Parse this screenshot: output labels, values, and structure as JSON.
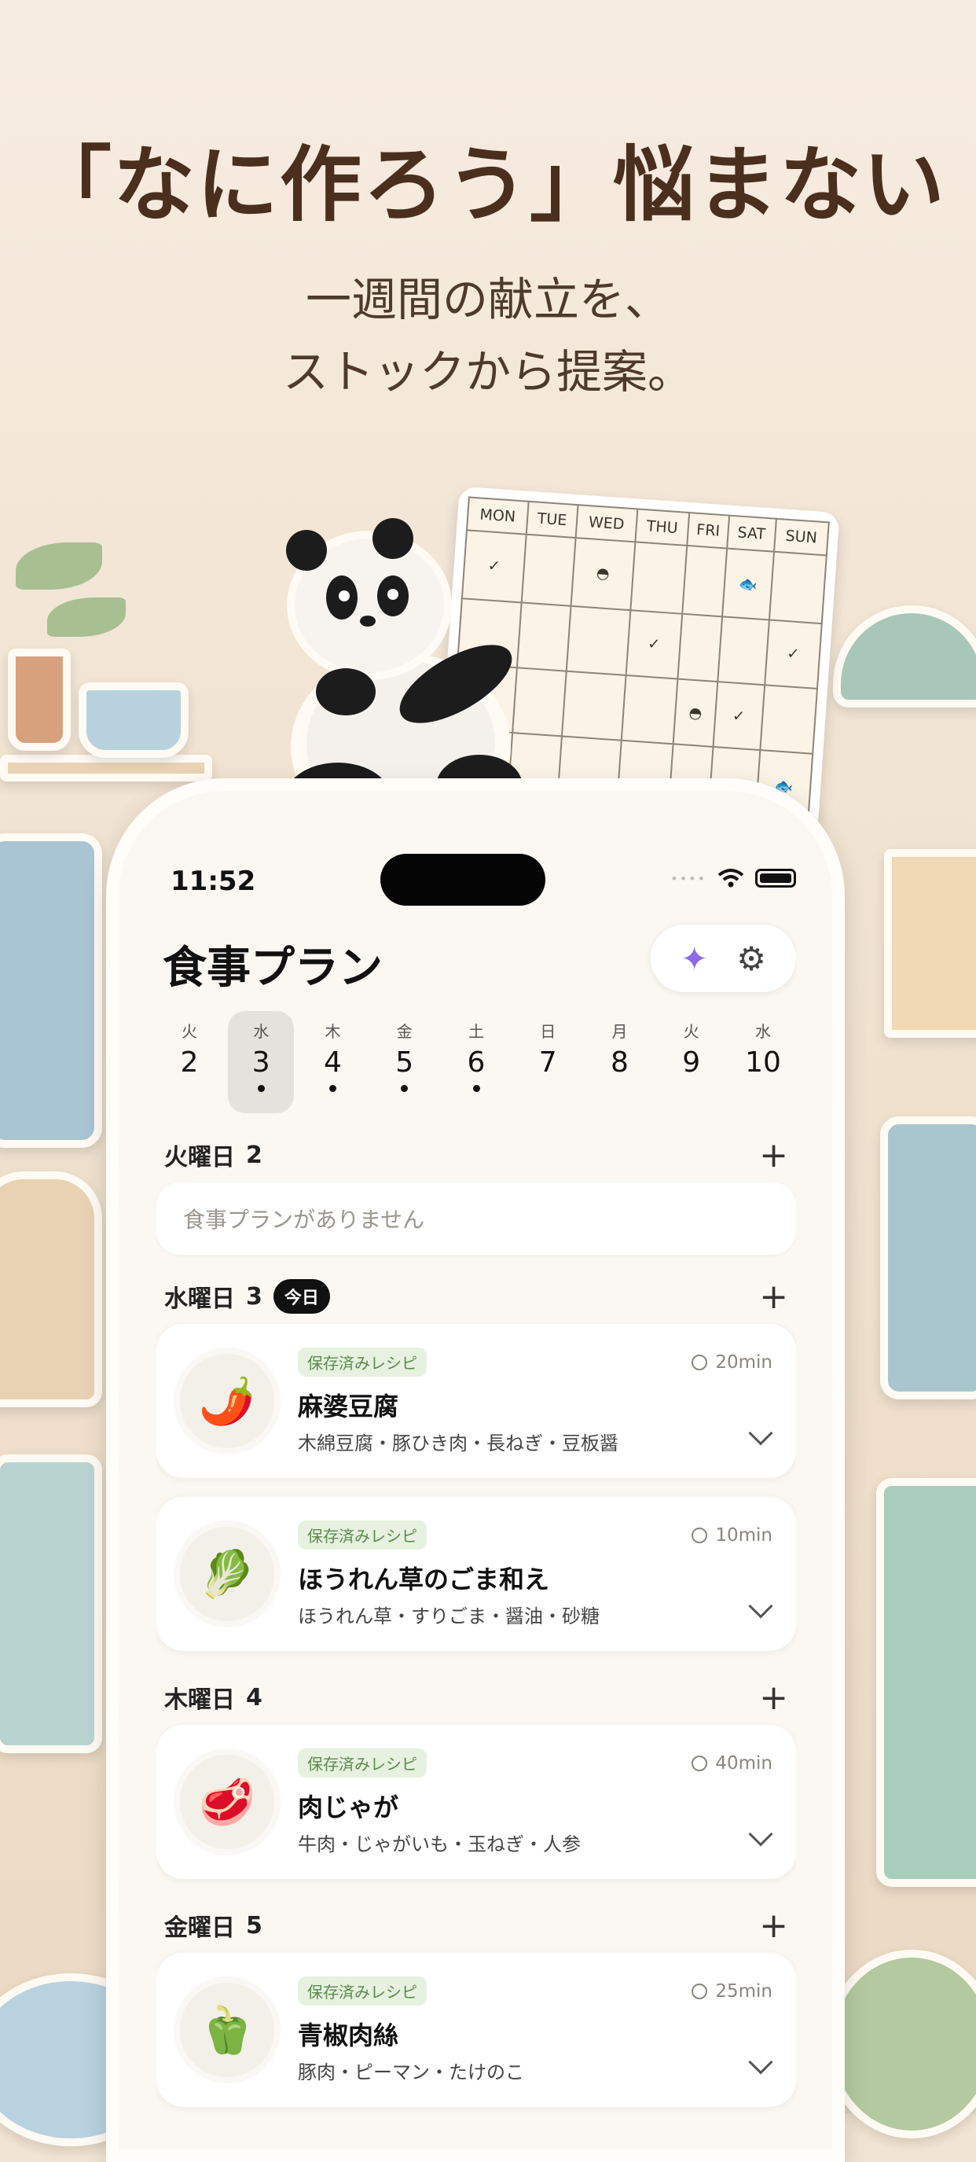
{
  "promo": {
    "headline": "「なに作ろう」悩まない",
    "sub_line1": "一週間の献立を、",
    "sub_line2": "ストックから提案。"
  },
  "calendar_illustration": {
    "days": [
      "MON",
      "TUE",
      "WED",
      "THU",
      "FRI",
      "SAT",
      "SUN"
    ]
  },
  "status": {
    "time": "11:52"
  },
  "app": {
    "title": "食事プラン",
    "sparkle_icon": "✦",
    "gear_icon": "⚙"
  },
  "week": [
    {
      "name": "火",
      "num": "2",
      "dot": false,
      "selected": false
    },
    {
      "name": "水",
      "num": "3",
      "dot": true,
      "selected": true
    },
    {
      "name": "木",
      "num": "4",
      "dot": true,
      "selected": false
    },
    {
      "name": "金",
      "num": "5",
      "dot": true,
      "selected": false
    },
    {
      "name": "土",
      "num": "6",
      "dot": true,
      "selected": false
    },
    {
      "name": "日",
      "num": "7",
      "dot": false,
      "selected": false
    },
    {
      "name": "月",
      "num": "8",
      "dot": false,
      "selected": false
    },
    {
      "name": "火",
      "num": "9",
      "dot": false,
      "selected": false
    },
    {
      "name": "水",
      "num": "10",
      "dot": false,
      "selected": false
    }
  ],
  "sections": {
    "tue": {
      "label": "火曜日",
      "num": "2",
      "empty_text": "食事プランがありません"
    },
    "wed": {
      "label": "水曜日",
      "num": "3",
      "today": "今日"
    },
    "thu": {
      "label": "木曜日",
      "num": "4"
    },
    "fri": {
      "label": "金曜日",
      "num": "5"
    }
  },
  "plus_symbol": "+",
  "recipes": [
    {
      "badge": "保存済みレシピ",
      "duration": "20min",
      "name": "麻婆豆腐",
      "ingredients": "木綿豆腐・豚ひき肉・長ねぎ・豆板醤",
      "emoji": "🌶️"
    },
    {
      "badge": "保存済みレシピ",
      "duration": "10min",
      "name": "ほうれん草のごま和え",
      "ingredients": "ほうれん草・すりごま・醤油・砂糖",
      "emoji": "🥬"
    },
    {
      "badge": "保存済みレシピ",
      "duration": "40min",
      "name": "肉じゃが",
      "ingredients": "牛肉・じゃがいも・玉ねぎ・人参",
      "emoji": "🥩"
    },
    {
      "badge": "保存済みレシピ",
      "duration": "25min",
      "name": "青椒肉絲",
      "ingredients": "豚肉・ピーマン・たけのこ",
      "emoji": "🫑"
    }
  ]
}
